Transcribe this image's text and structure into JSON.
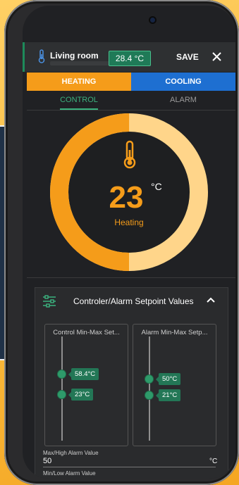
{
  "header": {
    "room": "Living room",
    "current_temp": "28.4 °C",
    "save_label": "SAVE"
  },
  "mode_tabs": [
    {
      "label": "HEATING",
      "active": true
    },
    {
      "label": "COOLING",
      "active": false
    }
  ],
  "sub_tabs": [
    {
      "label": "CONTROL",
      "active": true
    },
    {
      "label": "ALARM",
      "active": false
    }
  ],
  "gauge": {
    "value": "23",
    "unit": "°C",
    "mode": "Heating",
    "fill_fraction": 0.5,
    "colors": {
      "active": "#f59c1a",
      "track": "#ffd58a"
    }
  },
  "setpoint_panel": {
    "title": "Controler/Alarm Setpoint Values",
    "control": {
      "title": "Control Min-Max Set...",
      "max": "58.4°C",
      "min": "23°C"
    },
    "alarm": {
      "title": "Alarm Min-Max Setp...",
      "max": "50°C",
      "min": "21°C"
    },
    "max_alarm": {
      "label": "Max/High Alarm Value",
      "value": "50",
      "unit": "°C"
    },
    "min_alarm": {
      "label": "Min/Low Alarm Value"
    }
  },
  "icons": [
    "thermometer-icon",
    "close-icon",
    "sliders-icon",
    "chevron-up-icon"
  ],
  "colors": {
    "accent_heat": "#f59c1a",
    "accent_cool": "#1e6fd1",
    "accent_green": "#3bb27e"
  }
}
